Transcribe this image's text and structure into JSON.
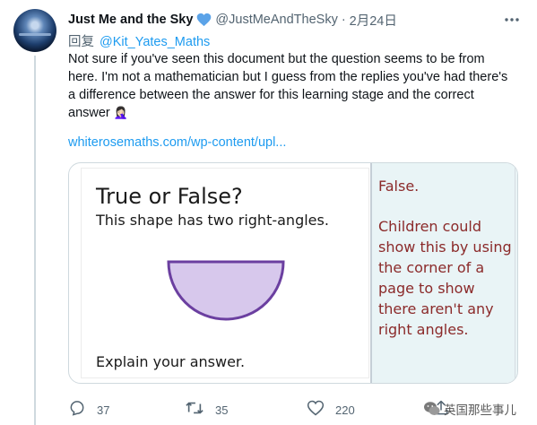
{
  "tweet": {
    "display_name": "Just Me and the Sky",
    "verified_emoji": "💙",
    "handle": "@JustMeAndTheSky",
    "date": "2月24日",
    "separator": "·",
    "reply_prefix": "回复",
    "reply_mention": "@Kit_Yates_Maths",
    "body": "Not sure if you've seen this document but the question seems to be from here. I'm not a mathematician but I guess from the replies you've had there's a difference between the answer for this learning stage and the correct answer",
    "body_emoji": "🤦🏻‍♀️",
    "link": "whiterosemaths.com/wp-content/upl..."
  },
  "card": {
    "title": "True or False?",
    "question": "This shape has two right-angles.",
    "explain": "Explain your answer.",
    "answer": "False.",
    "answer_explanation": "Children could show this by using the corner of a page to show there aren't any right angles.",
    "shape_fill": "#d7c8ec",
    "shape_stroke": "#6b3fa0",
    "answer_color": "#8b2a2a",
    "answer_panel_bg": "#e9f4f6"
  },
  "actions": {
    "reply_count": "37",
    "retweet_count": "35",
    "like_count": "220"
  },
  "watermark": {
    "text": "英国那些事儿"
  },
  "colors": {
    "link": "#1d9bf0",
    "muted": "#536471",
    "text": "#0f1419"
  }
}
